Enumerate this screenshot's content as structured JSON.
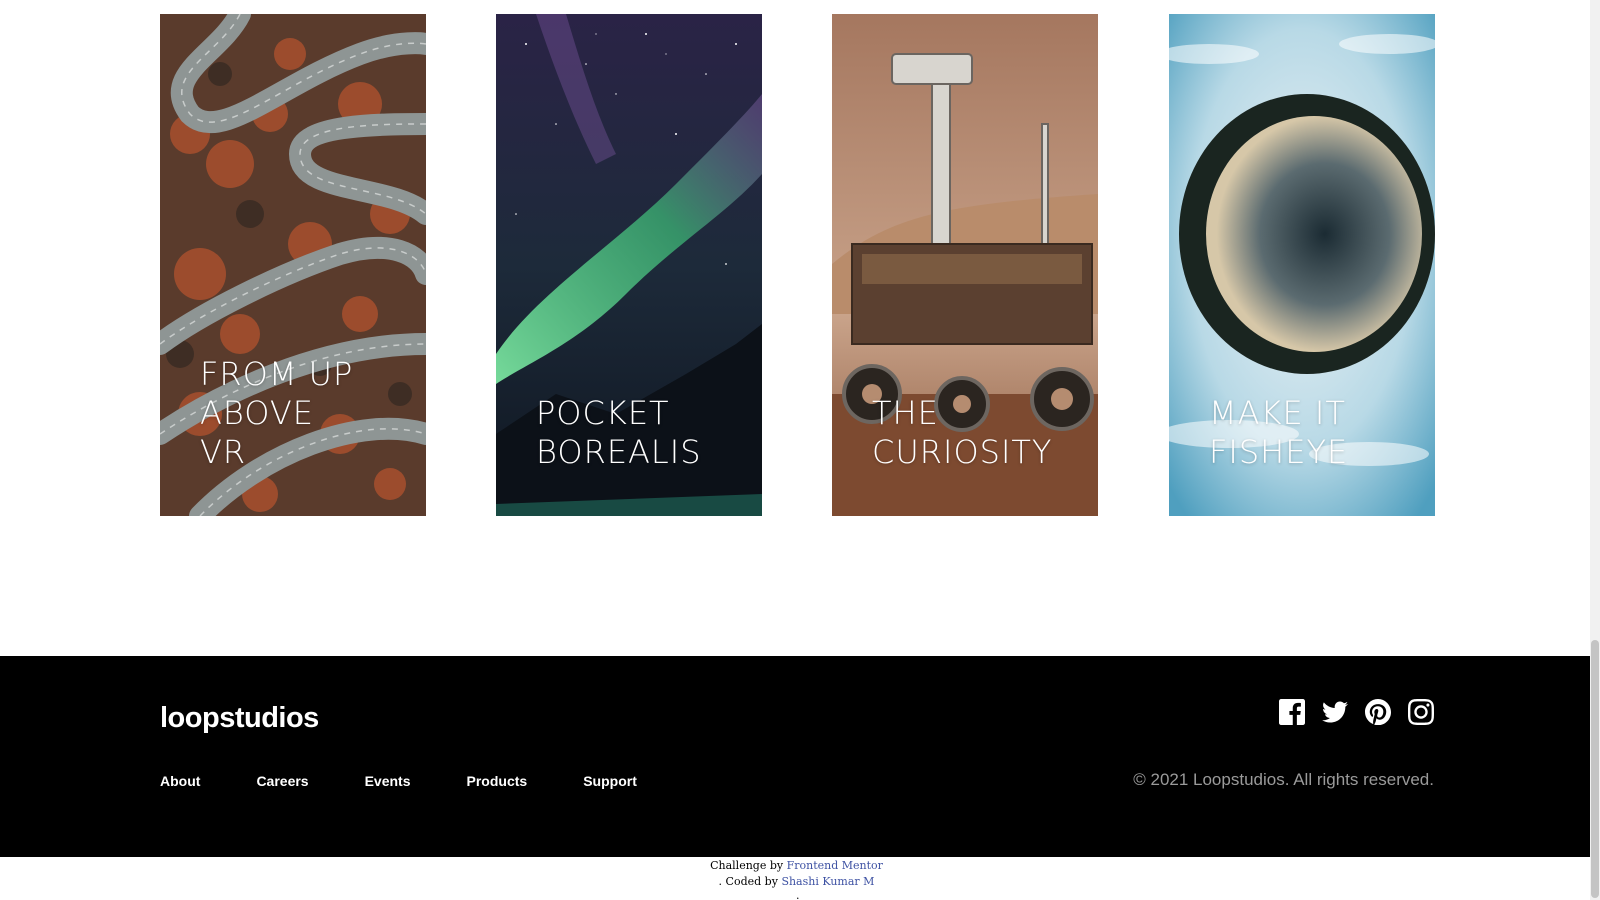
{
  "cards": [
    {
      "title": "FROM UP\nABOVE\nVR"
    },
    {
      "title": "POCKET\nBOREALIS"
    },
    {
      "title": "THE\nCURIOSITY"
    },
    {
      "title": "MAKE IT\nFISHEYE"
    }
  ],
  "footer": {
    "logo": "loopstudios",
    "nav": [
      "About",
      "Careers",
      "Events",
      "Products",
      "Support"
    ],
    "socials": [
      "facebook-icon",
      "twitter-icon",
      "pinterest-icon",
      "instagram-icon"
    ],
    "copyright": "© 2021 Loopstudios. All rights reserved."
  },
  "attribution": {
    "challenge_prefix": "Challenge by",
    "challenge_link": "Frontend Mentor",
    "coded_prefix": ". Coded by",
    "coded_link": "Shashi Kumar M",
    "trailing": "."
  },
  "colors": {
    "footer_bg": "#000000",
    "link": "#3e52a3",
    "muted_text": "#9a9a9a"
  }
}
